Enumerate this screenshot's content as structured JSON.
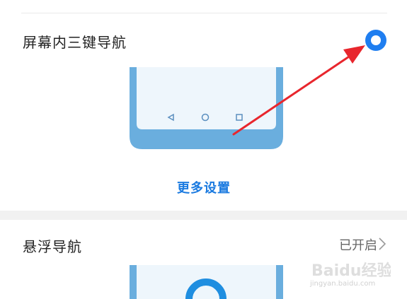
{
  "navigation_settings": {
    "three_key": {
      "title": "屏幕内三键导航",
      "selected": true
    },
    "more_settings_label": "更多设置",
    "floating": {
      "title": "悬浮导航",
      "status": "已开启"
    }
  },
  "watermark": {
    "logo_text": "Baidu经验",
    "url_text": "jingyan.baidu.com"
  },
  "colors": {
    "accent": "#1f7ef0",
    "link": "#1a7ae0",
    "phone_frame": "#6aaede",
    "phone_screen": "#eef6fc",
    "arrow": "#e8262d"
  },
  "icons": {
    "back": "triangle-left-icon",
    "home": "circle-icon",
    "recents": "square-icon",
    "chevron": "chevron-right-icon"
  }
}
